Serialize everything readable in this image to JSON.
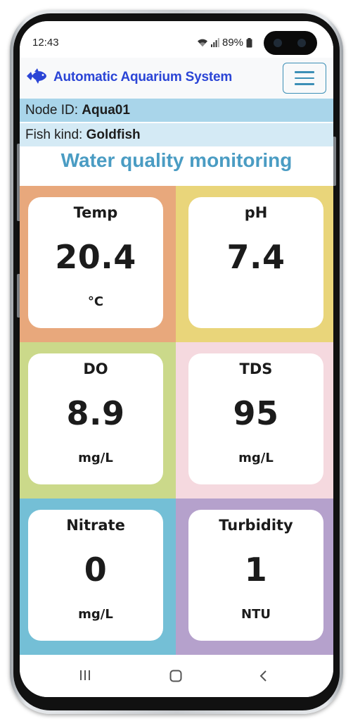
{
  "status_bar": {
    "time": "12:43",
    "battery": "89%",
    "icons": [
      "wifi-icon",
      "signal-icon",
      "battery-icon"
    ]
  },
  "navbar": {
    "brand_title": "Automatic Aquarium System",
    "brand_icon": "fish-icon",
    "menu_icon": "hamburger-menu-icon"
  },
  "info": {
    "node_label": "Node ID:",
    "node_value": "Aqua01",
    "fish_label": "Fish kind:",
    "fish_value": "Goldfish"
  },
  "section_title": "Water quality monitoring",
  "metrics": [
    {
      "label": "Temp",
      "value": "20.4",
      "unit": "°C",
      "color": "#e8a87c"
    },
    {
      "label": "pH",
      "value": "7.4",
      "unit": "",
      "color": "#e9d57a"
    },
    {
      "label": "DO",
      "value": "8.9",
      "unit": "mg/L",
      "color": "#cbd98a"
    },
    {
      "label": "TDS",
      "value": "95",
      "unit": "mg/L",
      "color": "#f5d9df"
    },
    {
      "label": "Nitrate",
      "value": "0",
      "unit": "mg/L",
      "color": "#74bfd6"
    },
    {
      "label": "Turbidity",
      "value": "1",
      "unit": "NTU",
      "color": "#b5a1cc"
    }
  ],
  "colors": {
    "brand": "#2b45d6",
    "accent": "#4a9cc3",
    "info_row_1": "#a9d5ea",
    "info_row_2": "#d4eaf5"
  },
  "bottom_nav": {
    "icons": [
      "recents-icon",
      "home-icon",
      "back-icon"
    ]
  }
}
